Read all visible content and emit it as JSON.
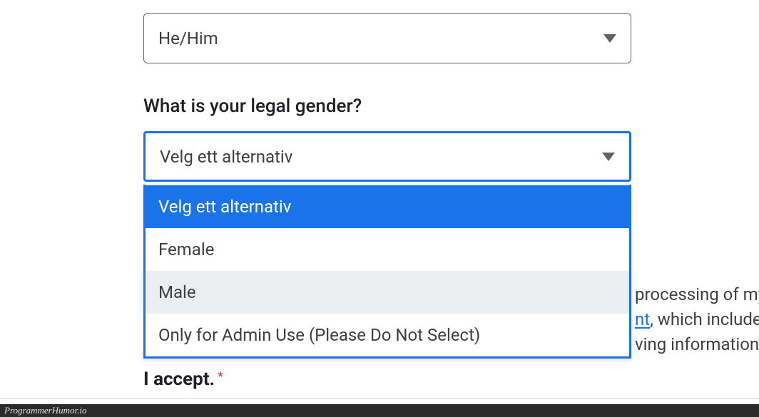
{
  "pronoun_select": {
    "value": "He/Him"
  },
  "legal_gender": {
    "label": "What is your legal gender?",
    "placeholder": "Velg ett alternativ",
    "options": [
      {
        "label": "Velg ett alternativ",
        "selected": true,
        "hovered": false
      },
      {
        "label": "Female",
        "selected": false,
        "hovered": false
      },
      {
        "label": "Male",
        "selected": false,
        "hovered": true
      },
      {
        "label": "Only for Admin Use (Please Do Not Select)",
        "selected": false,
        "hovered": false
      }
    ]
  },
  "background_text": {
    "line1": "processing of my",
    "link_fragment": "nt",
    "line2_rest": ", which includes",
    "line3": "ving information"
  },
  "accept_fragment": "I accept.",
  "footer": "ProgrammerHumor.io"
}
